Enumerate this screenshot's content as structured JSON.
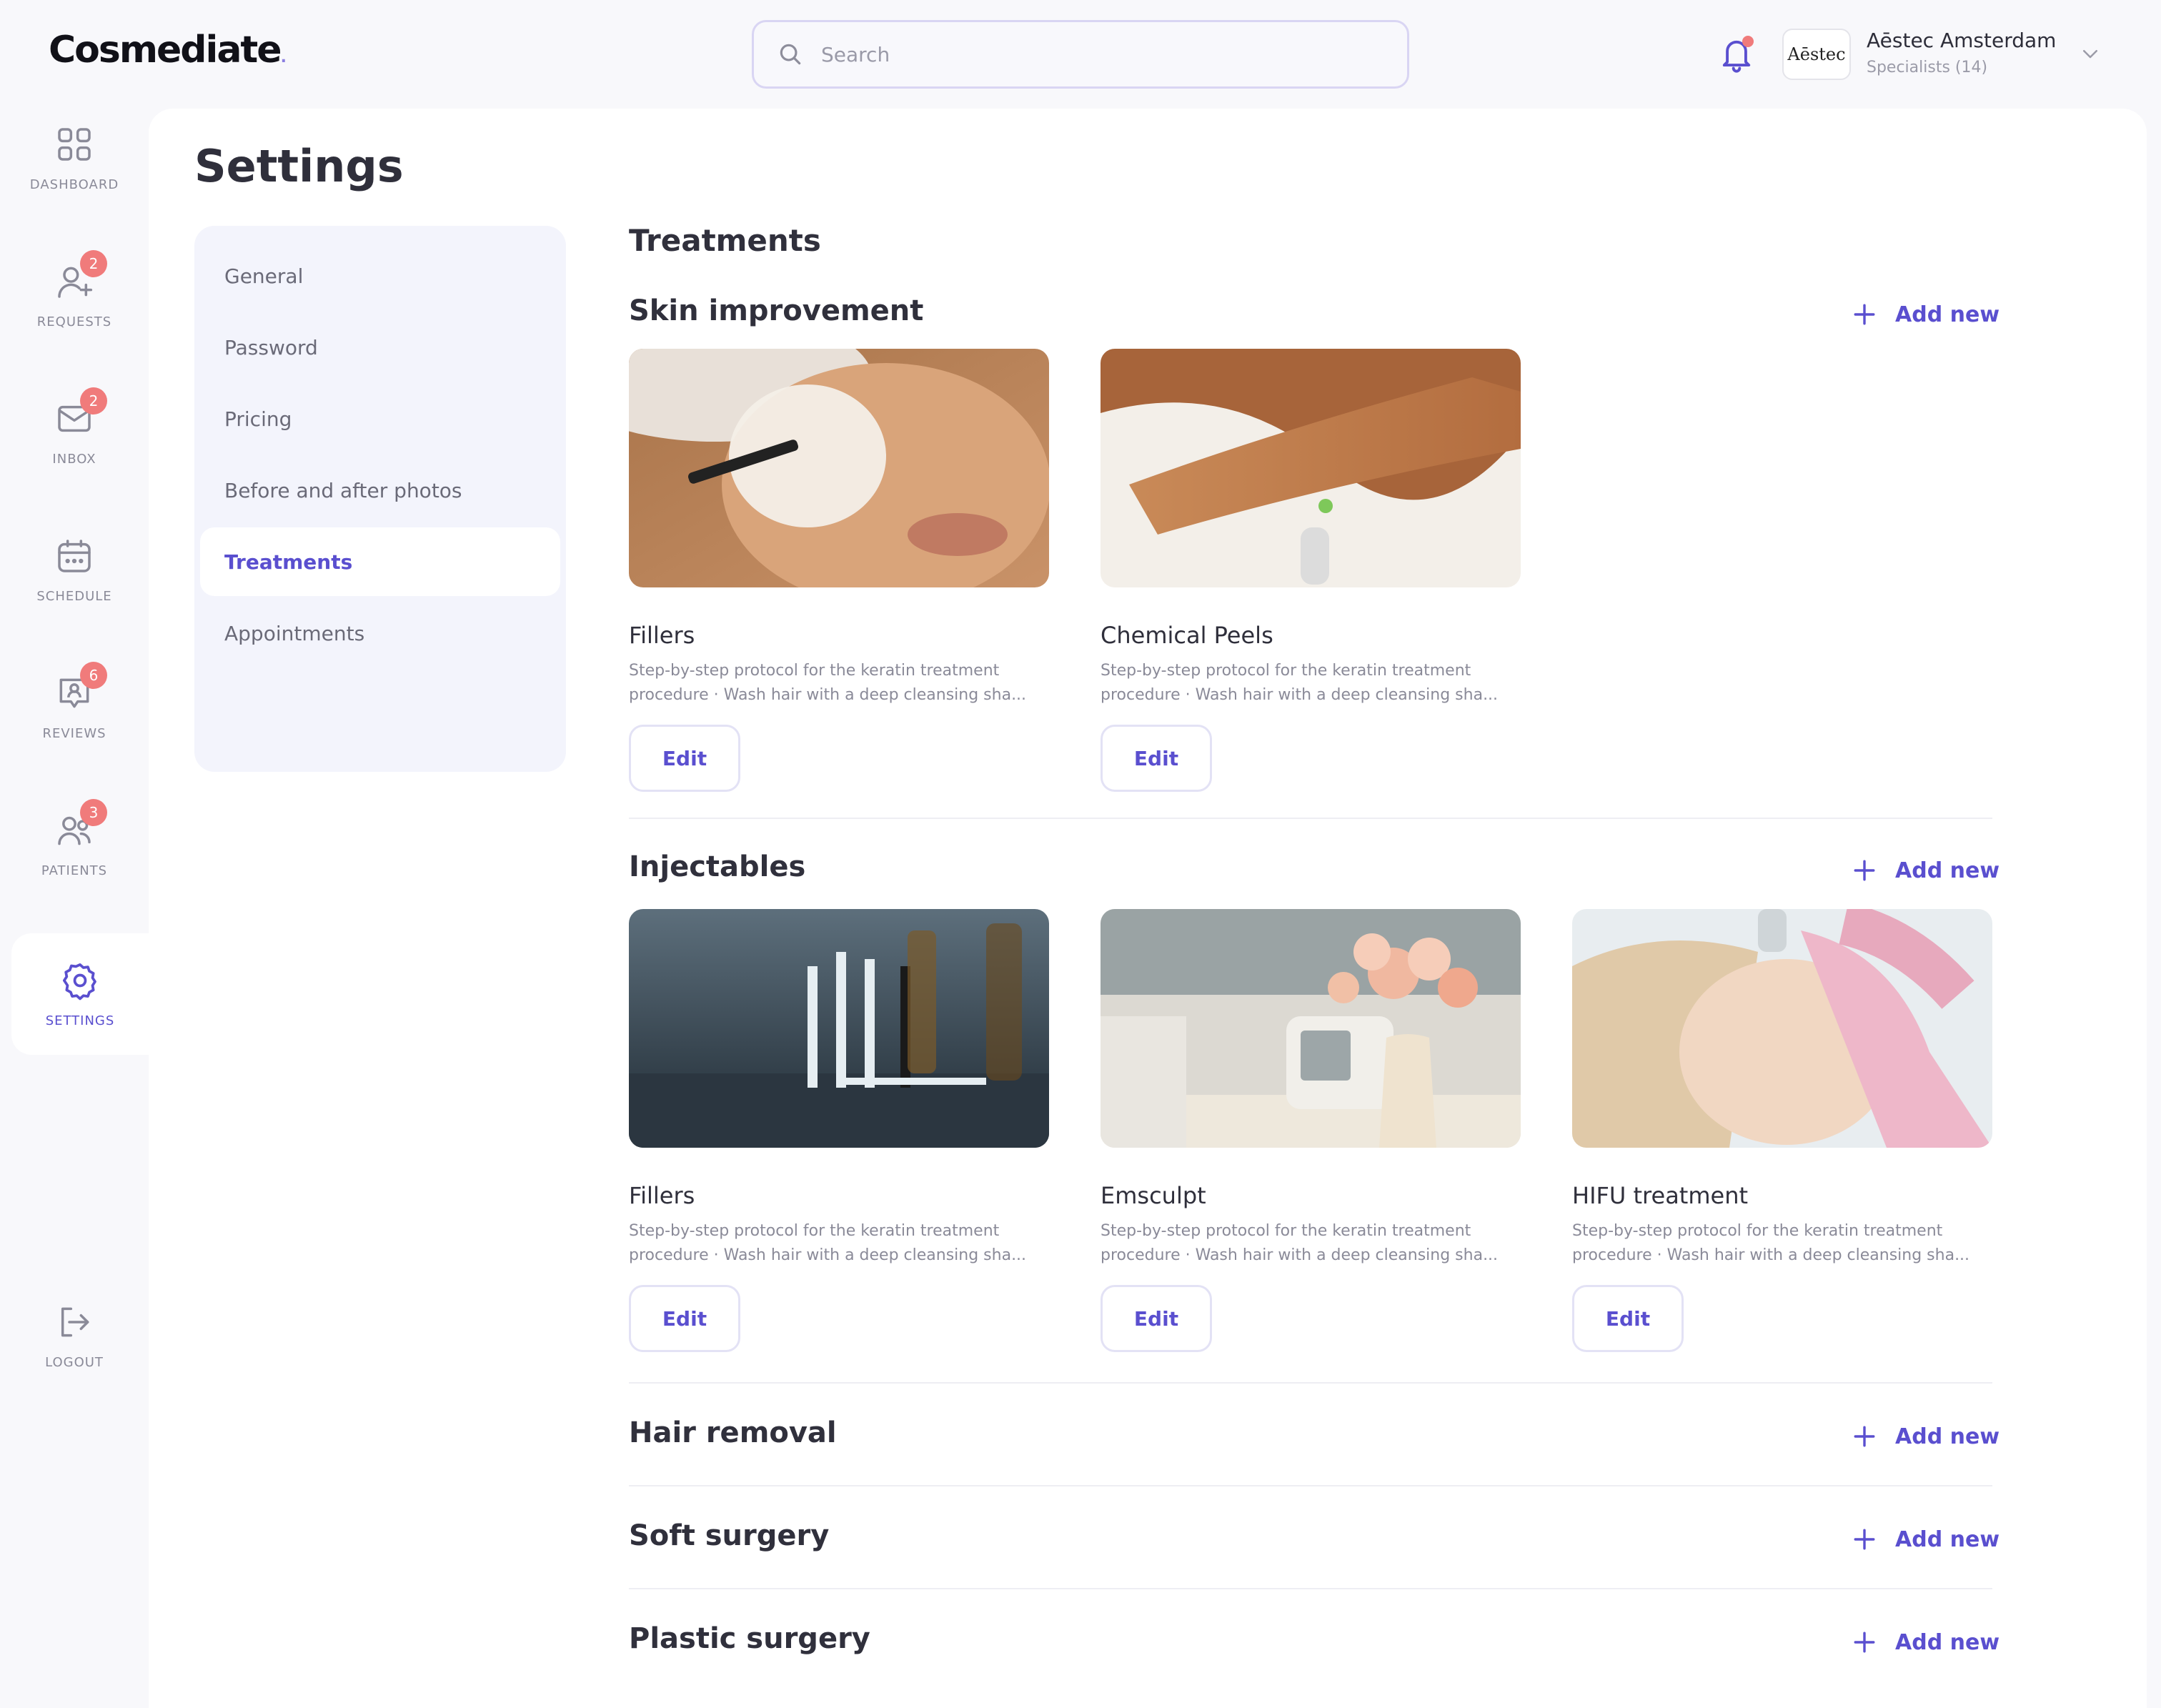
{
  "app": {
    "logo": "Cosmediate"
  },
  "search": {
    "placeholder": "Search"
  },
  "account": {
    "logo_text": "Aēstec",
    "name": "Aēstec Amsterdam",
    "subtitle": "Specialists (14)"
  },
  "nav": {
    "items": [
      {
        "label": "DASHBOARD",
        "icon": "dashboard-icon"
      },
      {
        "label": "REQUESTS",
        "icon": "add-user-icon",
        "badge": "2"
      },
      {
        "label": "INBOX",
        "icon": "mail-icon",
        "badge": "2"
      },
      {
        "label": "SCHEDULE",
        "icon": "calendar-icon"
      },
      {
        "label": "REVIEWS",
        "icon": "review-icon",
        "badge": "6"
      },
      {
        "label": "PATIENTS",
        "icon": "users-icon",
        "badge": "3"
      },
      {
        "label": "SETTINGS",
        "icon": "gear-icon",
        "active": true
      },
      {
        "label": "LOGOUT",
        "icon": "logout-icon"
      }
    ]
  },
  "page": {
    "title": "Settings"
  },
  "settings_menu": {
    "items": [
      "General",
      "Password",
      "Pricing",
      "Before and after photos",
      "Treatments",
      "Appointments"
    ],
    "active": "Treatments"
  },
  "treatments": {
    "heading": "Treatments",
    "add_label": "Add new",
    "edit_label": "Edit",
    "categories": [
      {
        "title": "Skin improvement",
        "cards": [
          {
            "title": "Fillers",
            "desc": "Step-by-step protocol for the keratin treatment procedure · Wash hair with a deep cleansing sha..."
          },
          {
            "title": "Chemical Peels",
            "desc": "Step-by-step protocol for the keratin treatment procedure · Wash hair with a deep cleansing sha..."
          }
        ]
      },
      {
        "title": "Injectables",
        "cards": [
          {
            "title": "Fillers",
            "desc": "Step-by-step protocol for the keratin treatment procedure · Wash hair with a deep cleansing sha..."
          },
          {
            "title": "Emsculpt",
            "desc": "Step-by-step protocol for the keratin treatment procedure · Wash hair with a deep cleansing sha..."
          },
          {
            "title": "HIFU treatment",
            "desc": "Step-by-step protocol for the keratin treatment procedure · Wash hair with a deep cleansing sha..."
          }
        ]
      },
      {
        "title": "Hair removal",
        "cards": []
      },
      {
        "title": "Soft surgery",
        "cards": []
      },
      {
        "title": "Plastic surgery",
        "cards": []
      }
    ]
  },
  "colors": {
    "accent": "#5a4fcf",
    "badge": "#f07b7b",
    "menu_bg": "#f3f4fc",
    "page_bg": "#f8f8fb"
  }
}
